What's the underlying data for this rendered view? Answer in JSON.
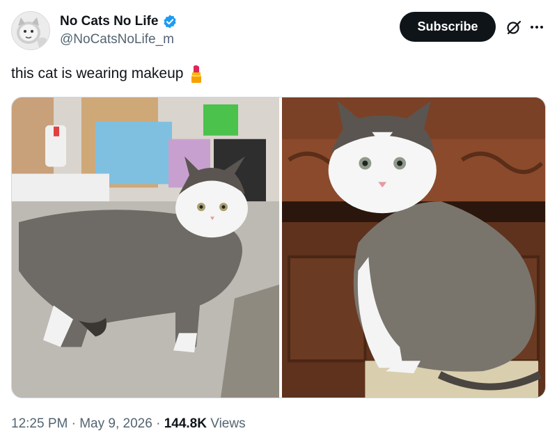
{
  "author": {
    "display_name": "No Cats No Life",
    "handle": "@NoCatsNoLife_m",
    "verified": true,
    "avatar": "avatar-cat-photo"
  },
  "actions": {
    "subscribe_label": "Subscribe",
    "grok_icon": "grok-icon",
    "more_icon": "more-icon"
  },
  "tweet": {
    "text": "this cat is wearing makeup",
    "emoji": "lipstick-icon"
  },
  "media": [
    {
      "description": "tabby cat with white face standing on sidewalk"
    },
    {
      "description": "tabby cat with white face sitting by wooden furniture"
    }
  ],
  "meta": {
    "time": "12:25 PM",
    "separator": "·",
    "date": "May 9, 2026",
    "views_count": "144.8K",
    "views_label": "Views"
  },
  "colors": {
    "verified_blue": "#1d9bf0",
    "text_primary": "#0f1419",
    "text_secondary": "#536471",
    "subscribe_bg": "#0f1419"
  }
}
